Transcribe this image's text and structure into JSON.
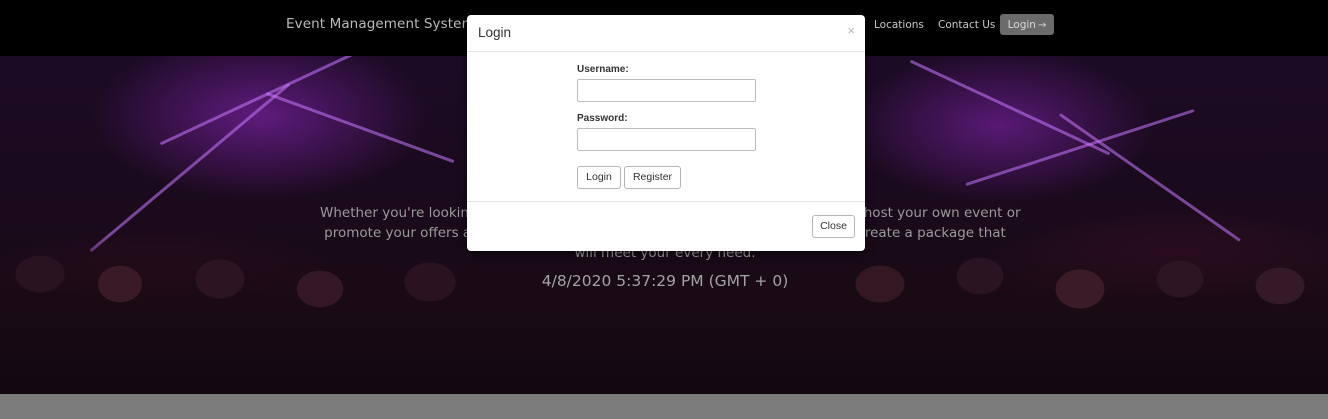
{
  "navbar": {
    "brand": "Event Management Systems",
    "links": [
      {
        "label": "Locations"
      },
      {
        "label": "Contact Us"
      }
    ],
    "login_label": "Login",
    "login_icon": "sign-in-icon"
  },
  "hero": {
    "line1": "Whether you're looking                                                                                          host your own event or",
    "line2": "promote your offers a                                                                                          create a package that",
    "line3": "will meet your every need.",
    "datetime": "4/8/2020 5:37:29 PM (GMT + 0)"
  },
  "modal": {
    "title": "Login",
    "close_x": "×",
    "username_label": "Username:",
    "username_value": "",
    "password_label": "Password:",
    "password_value": "",
    "login_button": "Login",
    "register_button": "Register",
    "close_button": "Close"
  }
}
